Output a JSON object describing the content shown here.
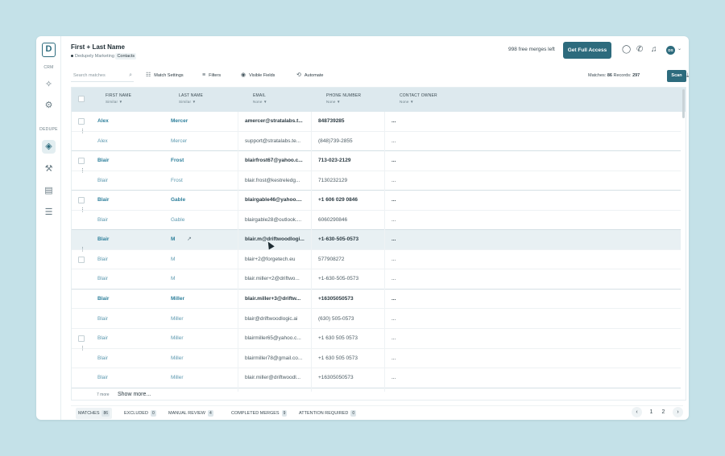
{
  "rail": {
    "crm_label": "CRM",
    "dedupe_label": "DEDUPE",
    "icons": [
      "logo-icon",
      "crm-icon",
      "gear-icon",
      "layers-icon",
      "hammer-icon",
      "file-search-icon",
      "list-icon"
    ]
  },
  "header": {
    "title": "First + Last Name",
    "subtitle_prefix": "Dedupely Marketing",
    "subtitle_object": "Contacts",
    "free_merges": "998 free merges left",
    "cta_label": "Get Full Access",
    "avatar_initials": "DS"
  },
  "toolbar": {
    "search_placeholder": "Search matches",
    "match_settings": "Match Settings",
    "filters": "Filters",
    "visible_fields": "Visible Fields",
    "automate": "Automate",
    "matches_label": "Matches:",
    "matches_count": "86",
    "records_label": "Records:",
    "records_count": "297",
    "scan_label": "Scan"
  },
  "columns": [
    {
      "label": "FIRST NAME",
      "sub": "Similar ▼"
    },
    {
      "label": "LAST NAME",
      "sub": "Similar ▼"
    },
    {
      "label": "EMAIL",
      "sub": "None ▼"
    },
    {
      "label": "PHONE NUMBER",
      "sub": "None ▼"
    },
    {
      "label": "CONTACT OWNER",
      "sub": "None ▼"
    }
  ],
  "rows": [
    {
      "first": "Alex",
      "last": "Mercer",
      "email": "amercer@stratalabs.t...",
      "phone": "848739285",
      "owner": "...",
      "kind": "master",
      "group_end": false,
      "cb": true
    },
    {
      "first": "Alex",
      "last": "Mercer",
      "email": "support@stratalabs.te...",
      "phone": "(848)739-2855",
      "owner": "...",
      "kind": "dup",
      "group_end": true,
      "kebab": true
    },
    {
      "first": "Blair",
      "last": "Frost",
      "email": "blairfrost67@yahoo.c...",
      "phone": "713-023-2129",
      "owner": "...",
      "kind": "master",
      "group_end": false,
      "cb": true
    },
    {
      "first": "Blair",
      "last": "Frost",
      "email": "blair.frost@kestreledg...",
      "phone": "7130232129",
      "owner": "...",
      "kind": "dup",
      "group_end": true,
      "kebab": true
    },
    {
      "first": "Blair",
      "last": "Gable",
      "email": "blairgable46@yahoo....",
      "phone": "+1 606 029 0846",
      "owner": "...",
      "kind": "master",
      "group_end": false,
      "cb": true
    },
    {
      "first": "Blair",
      "last": "Gable",
      "email": "blairgable28@outlook....",
      "phone": "6060290846",
      "owner": "...",
      "kind": "dup",
      "group_end": true,
      "kebab": true
    },
    {
      "first": "Blair",
      "last": "M",
      "email": "blair.m@driftwoodlogi...",
      "phone": "+1-630-505-0573",
      "owner": "...",
      "kind": "master",
      "group_end": false,
      "hl": true,
      "ext": true
    },
    {
      "first": "Blair",
      "last": "M",
      "email": "blair+2@forgetech.eu",
      "phone": "577908272",
      "owner": "...",
      "kind": "dup",
      "group_end": false,
      "cb": true,
      "kebab": true
    },
    {
      "first": "Blair",
      "last": "M",
      "email": "blair.miller+2@driftwo...",
      "phone": "+1-630-505-0573",
      "owner": "...",
      "kind": "dup",
      "group_end": true
    },
    {
      "first": "Blair",
      "last": "Miller",
      "email": "blair.miller+3@driftw...",
      "phone": "+16305050573",
      "owner": "...",
      "kind": "master",
      "group_end": false
    },
    {
      "first": "Blair",
      "last": "Miller",
      "email": "blair@driftwoodlogic.ai",
      "phone": "(630) 505-0573",
      "owner": "...",
      "kind": "dup",
      "group_end": false
    },
    {
      "first": "Blair",
      "last": "Miller",
      "email": "blairmiller65@yahoo.c...",
      "phone": "+1 630 505 0573",
      "owner": "...",
      "kind": "dup",
      "group_end": false,
      "cb": true
    },
    {
      "first": "Blair",
      "last": "Miller",
      "email": "blairmiller78@gmail.co...",
      "phone": "+1 630 505 0573",
      "owner": "...",
      "kind": "dup",
      "group_end": false,
      "kebab": true
    },
    {
      "first": "Blair",
      "last": "Miller",
      "email": "blair.miller@driftwoodl...",
      "phone": "+16305050573",
      "owner": "...",
      "kind": "dup",
      "group_end": true
    }
  ],
  "footer": {
    "more_count": "7 more",
    "show_more": "Show more..."
  },
  "tabs": [
    {
      "label": "MATCHES",
      "count": "86",
      "active": true
    },
    {
      "label": "EXCLUDED",
      "count": "0",
      "active": false
    },
    {
      "label": "MANUAL REVIEW",
      "count": "4",
      "active": false
    },
    {
      "label": "COMPLETED MERGES",
      "count": "9",
      "active": false
    },
    {
      "label": "ATTENTION REQUIRED",
      "count": "0",
      "active": false
    }
  ],
  "pagination": {
    "prev": "‹",
    "pages": [
      "1",
      "2"
    ],
    "next": "›"
  }
}
